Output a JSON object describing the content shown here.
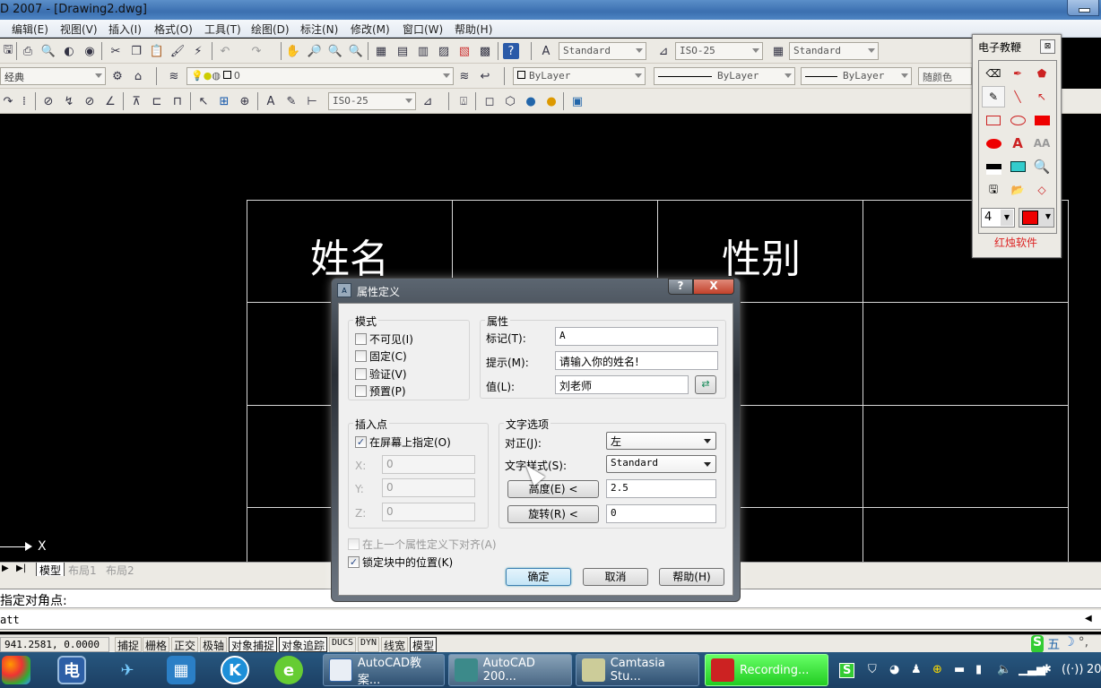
{
  "window": {
    "title": "D 2007 - [Drawing2.dwg]"
  },
  "menu": [
    "编辑(E)",
    "视图(V)",
    "插入(I)",
    "格式(O)",
    "工具(T)",
    "绘图(D)",
    "标注(N)",
    "修改(M)",
    "窗口(W)",
    "帮助(H)"
  ],
  "toolbar1": {
    "text_style": "Standard",
    "dim_style": "ISO-25",
    "table_style": "Standard"
  },
  "toolbar2": {
    "workspace": "经典",
    "layer": "0",
    "color": "ByLayer",
    "linetype": "ByLayer",
    "lineweight": "ByLayer",
    "plotstyle": "随颜色"
  },
  "toolbar3": {
    "dim_style": "ISO-25"
  },
  "drawing": {
    "cells": [
      "姓名",
      "性别"
    ],
    "axis_label": "X"
  },
  "layout_tabs": [
    "模型",
    "布局1",
    "布局2"
  ],
  "command_line": {
    "line1": "指定对角点:",
    "line2": "att"
  },
  "status": {
    "coords": "941.2581, 0.0000",
    "toggles": [
      {
        "label": "捕捉",
        "on": false
      },
      {
        "label": "栅格",
        "on": false
      },
      {
        "label": "正交",
        "on": false
      },
      {
        "label": "极轴",
        "on": false
      },
      {
        "label": "对象捕捉",
        "on": true
      },
      {
        "label": "对象追踪",
        "on": true
      },
      {
        "label": "DUCS",
        "on": false
      },
      {
        "label": "DYN",
        "on": false
      },
      {
        "label": "线宽",
        "on": false
      },
      {
        "label": "模型",
        "on": true
      }
    ],
    "ime": [
      "S",
      "五",
      "☽",
      "°,"
    ]
  },
  "palette": {
    "title": "电子教鞭",
    "close": "⊠",
    "tools": [
      "eraser",
      "pen",
      "fill",
      "pointer",
      "line",
      "arrow",
      "rect",
      "ellipse",
      "filled-rect",
      "filled-ellipse",
      "text",
      "text-outline",
      "black-bar",
      "screen",
      "magnifier",
      "save",
      "open",
      "diamond"
    ],
    "width_value": "4",
    "color": "#ff0000",
    "footer": "红烛软件"
  },
  "dialog": {
    "title": "属性定义",
    "help_btn": "?",
    "close_btn": "X",
    "mode": {
      "label": "模式",
      "options": [
        {
          "label": "不可见(I)",
          "checked": false
        },
        {
          "label": "固定(C)",
          "checked": false
        },
        {
          "label": "验证(V)",
          "checked": false
        },
        {
          "label": "预置(P)",
          "checked": false
        }
      ]
    },
    "attribute": {
      "label": "属性",
      "tag_label": "标记(T):",
      "tag_value": "A",
      "prompt_label": "提示(M):",
      "prompt_value": "请输入你的姓名!",
      "value_label": "值(L):",
      "value_value": "刘老师"
    },
    "insertion": {
      "label": "插入点",
      "specify_onscreen": "在屏幕上指定(O)",
      "specify_checked": true,
      "x_label": "X:",
      "x": "0",
      "y_label": "Y:",
      "y": "0",
      "z_label": "Z:",
      "z": "0"
    },
    "text_options": {
      "label": "文字选项",
      "justify_label": "对正(J):",
      "justify_value": "左",
      "style_label": "文字样式(S):",
      "style_value": "Standard",
      "height_btn": "高度(E) <",
      "height_value": "2.5",
      "rotation_btn": "旋转(R) <",
      "rotation_value": "0"
    },
    "align_below": {
      "label": "在上一个属性定义下对齐(A)",
      "checked": false
    },
    "lock_position": {
      "label": "锁定块中的位置(K)",
      "checked": true
    },
    "ok": "确定",
    "cancel": "取消",
    "help": "帮助(H)"
  },
  "taskbar": {
    "tasks": [
      {
        "label": "AutoCAD教案...",
        "icon": "word"
      },
      {
        "label": "AutoCAD 200...",
        "icon": "autocad"
      },
      {
        "label": "Camtasia Stu...",
        "icon": "camtasia"
      },
      {
        "label": "Recording...",
        "icon": "recorder"
      }
    ],
    "clock": "20"
  }
}
